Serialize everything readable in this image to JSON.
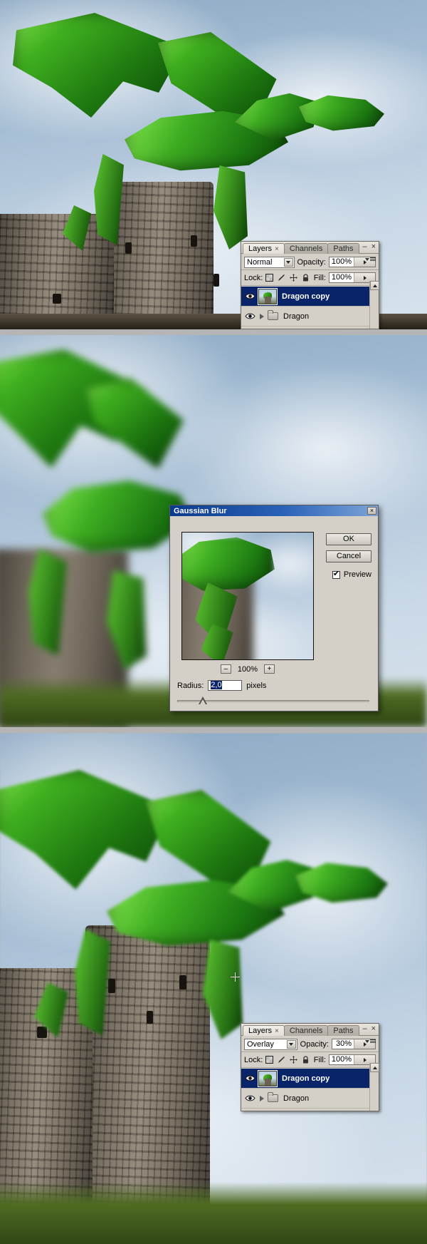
{
  "app": "Adobe Photoshop",
  "panels": {
    "layers_top": {
      "tabs": [
        {
          "label": "Layers",
          "close": "×",
          "active": true
        },
        {
          "label": "Channels",
          "active": false
        },
        {
          "label": "Paths",
          "active": false
        }
      ],
      "window_buttons": {
        "minimize": "–",
        "close": "×"
      },
      "blend_mode": "Normal",
      "opacity_label": "Opacity:",
      "opacity_value": "100%",
      "lock_label": "Lock:",
      "lock_icons": [
        "transparency-lock-icon",
        "brush-lock-icon",
        "move-lock-icon",
        "all-lock-icon"
      ],
      "fill_label": "Fill:",
      "fill_value": "100%",
      "layers": [
        {
          "name": "Dragon copy",
          "selected": true,
          "type": "layer",
          "visible": true
        },
        {
          "name": "Dragon",
          "selected": false,
          "type": "group",
          "visible": true
        }
      ]
    },
    "layers_bottom": {
      "tabs": [
        {
          "label": "Layers",
          "close": "×",
          "active": true
        },
        {
          "label": "Channels",
          "active": false
        },
        {
          "label": "Paths",
          "active": false
        }
      ],
      "window_buttons": {
        "minimize": "–",
        "close": "×"
      },
      "blend_mode": "Overlay",
      "opacity_label": "Opacity:",
      "opacity_value": "30%",
      "lock_label": "Lock:",
      "lock_icons": [
        "transparency-lock-icon",
        "brush-lock-icon",
        "move-lock-icon",
        "all-lock-icon"
      ],
      "fill_label": "Fill:",
      "fill_value": "100%",
      "layers": [
        {
          "name": "Dragon copy",
          "selected": true,
          "type": "layer",
          "visible": true
        },
        {
          "name": "Dragon",
          "selected": false,
          "type": "group",
          "visible": true
        }
      ]
    }
  },
  "dialog": {
    "title": "Gaussian Blur",
    "close_label": "×",
    "ok_label": "OK",
    "cancel_label": "Cancel",
    "preview_label": "Preview",
    "preview_checked": true,
    "zoom_out_label": "–",
    "zoom_level": "100%",
    "zoom_in_label": "+",
    "radius_label": "Radius:",
    "radius_value": "2,0",
    "radius_units": "pixels"
  },
  "colors": {
    "selection_blue": "#0a246a",
    "panel_gray": "#d4d0c8",
    "title_blue": "#0b3a8c",
    "backdrop_gray": "#b5b5b5"
  }
}
